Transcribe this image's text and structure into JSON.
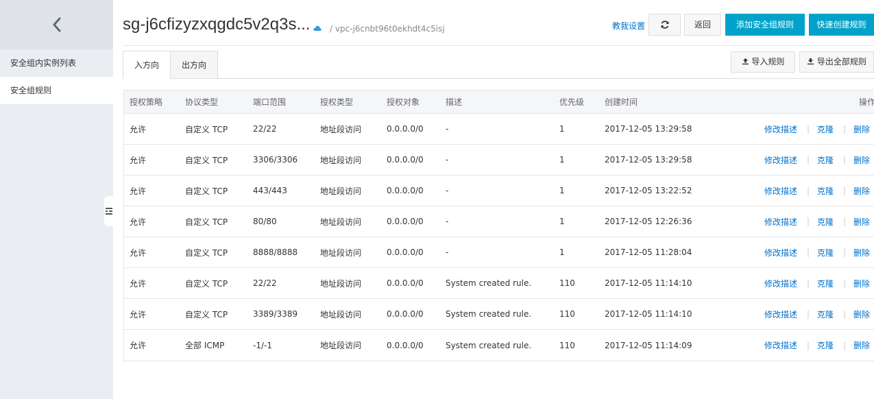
{
  "sidebar": {
    "items": [
      {
        "label": "安全组内实例列表",
        "active": false
      },
      {
        "label": "安全组规则",
        "active": true
      }
    ]
  },
  "header": {
    "title": "sg-j6cfizyzxqgdc5v2q3s...",
    "vpc": "/ vpc-j6cnbt96t0ekhdt4c5isj",
    "help_link": "教我设置",
    "back_label": "返回",
    "add_rule_label": "添加安全组规则",
    "quick_create_label": "快速创建规则"
  },
  "tabs": [
    {
      "label": "入方向",
      "active": true
    },
    {
      "label": "出方向",
      "active": false
    }
  ],
  "toolbar": {
    "import_label": "导入规则",
    "export_label": "导出全部规则"
  },
  "table": {
    "columns": [
      "授权策略",
      "协议类型",
      "端口范围",
      "授权类型",
      "授权对象",
      "描述",
      "优先级",
      "创建时间",
      "操作"
    ],
    "actions": [
      "修改描述",
      "克隆",
      "删除"
    ],
    "rows": [
      [
        "允许",
        "自定义 TCP",
        "22/22",
        "地址段访问",
        "0.0.0.0/0",
        "-",
        "1",
        "2017-12-05 13:29:58"
      ],
      [
        "允许",
        "自定义 TCP",
        "3306/3306",
        "地址段访问",
        "0.0.0.0/0",
        "-",
        "1",
        "2017-12-05 13:29:58"
      ],
      [
        "允许",
        "自定义 TCP",
        "443/443",
        "地址段访问",
        "0.0.0.0/0",
        "-",
        "1",
        "2017-12-05 13:22:52"
      ],
      [
        "允许",
        "自定义 TCP",
        "80/80",
        "地址段访问",
        "0.0.0.0/0",
        "-",
        "1",
        "2017-12-05 12:26:36"
      ],
      [
        "允许",
        "自定义 TCP",
        "8888/8888",
        "地址段访问",
        "0.0.0.0/0",
        "-",
        "1",
        "2017-12-05 11:28:04"
      ],
      [
        "允许",
        "自定义 TCP",
        "22/22",
        "地址段访问",
        "0.0.0.0/0",
        "System created rule.",
        "110",
        "2017-12-05 11:14:10"
      ],
      [
        "允许",
        "自定义 TCP",
        "3389/3389",
        "地址段访问",
        "0.0.0.0/0",
        "System created rule.",
        "110",
        "2017-12-05 11:14:10"
      ],
      [
        "允许",
        "全部 ICMP",
        "-1/-1",
        "地址段访问",
        "0.0.0.0/0",
        "System created rule.",
        "110",
        "2017-12-05 11:14:09"
      ]
    ]
  },
  "colors": {
    "accent": "#00a2ca",
    "link": "#0070cc",
    "sidebar_bg": "#eaedf1"
  },
  "icons": {
    "back": "chevron-left-icon",
    "refresh": "refresh-icon",
    "cloud": "cloud-icon",
    "upload": "upload-icon",
    "download": "download-icon",
    "collapse": "collapse-menu-icon"
  }
}
